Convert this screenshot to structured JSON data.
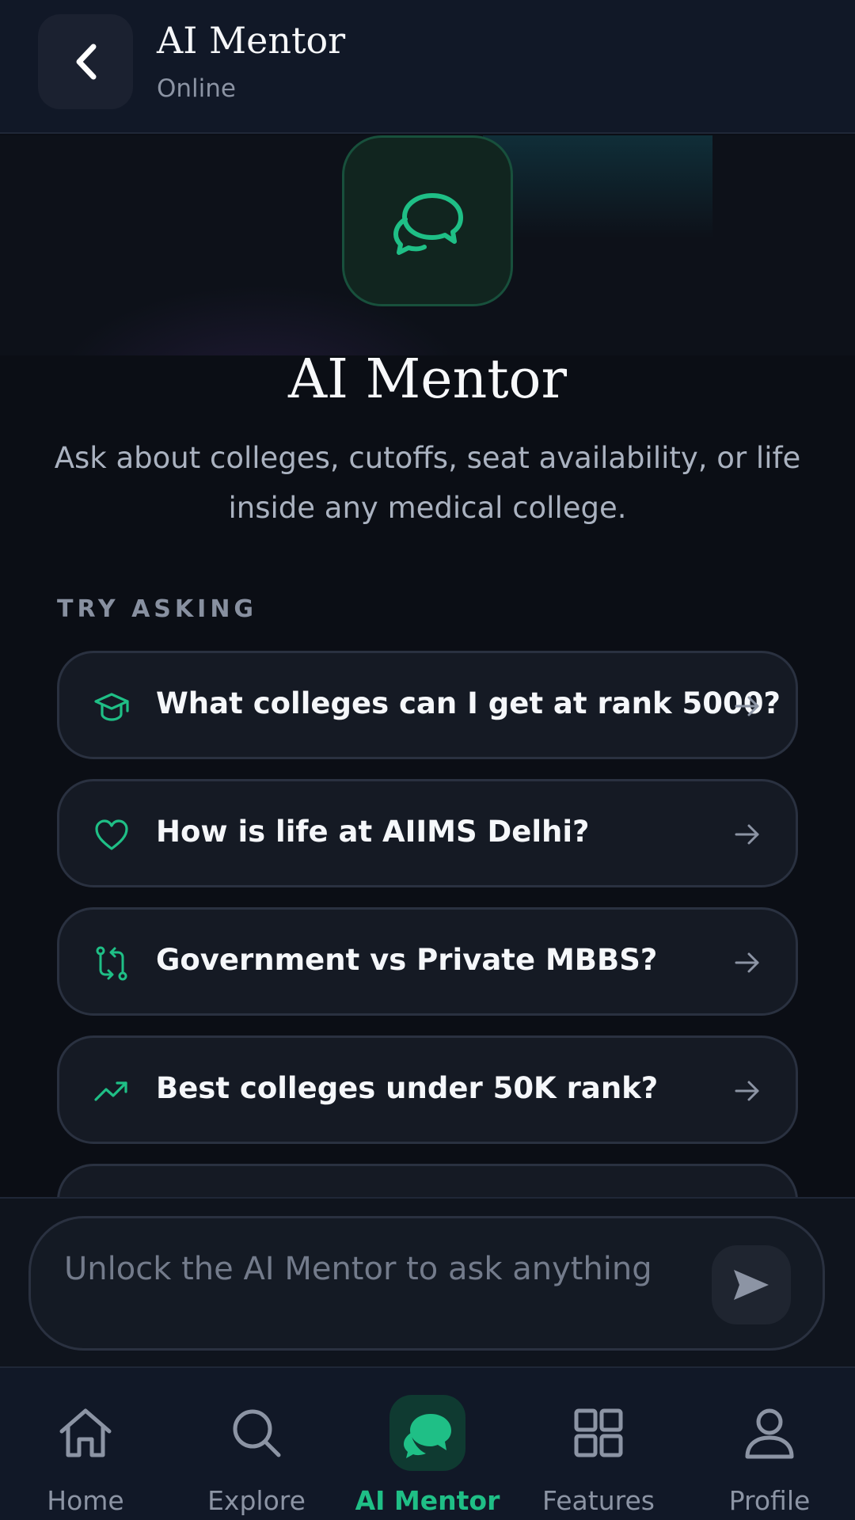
{
  "header": {
    "title": "AI Mentor",
    "status": "Online",
    "back_icon": "chevron-left-icon"
  },
  "hero": {
    "icon": "chat-bubbles-icon",
    "title": "AI Mentor",
    "subtitle": "Ask about colleges, cutoffs, seat availability, or life inside any medical college."
  },
  "section_label": "TRY ASKING",
  "suggestions": [
    {
      "icon": "graduation-cap-icon",
      "text": "What colleges can I get at rank 5000?"
    },
    {
      "icon": "heart-icon",
      "text": "How is life at AIIMS Delhi?"
    },
    {
      "icon": "compare-arrows-icon",
      "text": "Government vs Private MBBS?"
    },
    {
      "icon": "trending-up-icon",
      "text": "Best colleges under 50K rank?"
    },
    {
      "icon": "",
      "text": ""
    }
  ],
  "composer": {
    "placeholder": "Unlock the AI Mentor to ask anything",
    "send_icon": "send-icon"
  },
  "nav": [
    {
      "label": "Home",
      "icon": "home-icon",
      "active": false
    },
    {
      "label": "Explore",
      "icon": "search-icon",
      "active": false
    },
    {
      "label": "AI Mentor",
      "icon": "chat-bubbles-icon",
      "active": true
    },
    {
      "label": "Features",
      "icon": "grid-icon",
      "active": false
    },
    {
      "label": "Profile",
      "icon": "user-icon",
      "active": false
    }
  ],
  "colors": {
    "accent": "#1fbf86",
    "background": "#0b0e15",
    "card": "#151a24",
    "muted_text": "#8c94a4"
  }
}
